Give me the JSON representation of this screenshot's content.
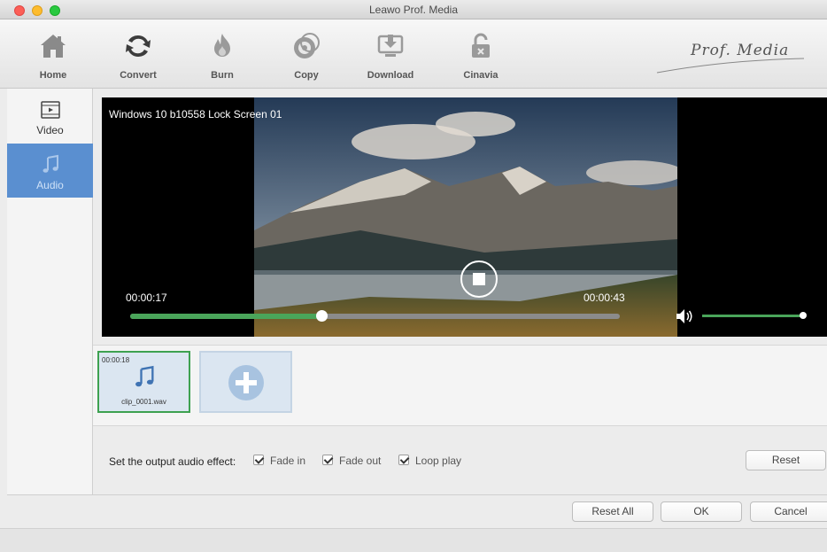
{
  "window": {
    "title": "Leawo Prof. Media"
  },
  "toolbar": {
    "items": [
      {
        "label": "Home",
        "icon": "home-icon"
      },
      {
        "label": "Convert",
        "icon": "convert-icon"
      },
      {
        "label": "Burn",
        "icon": "burn-icon"
      },
      {
        "label": "Copy",
        "icon": "copy-icon"
      },
      {
        "label": "Download",
        "icon": "download-icon"
      },
      {
        "label": "Cinavia",
        "icon": "cinavia-icon"
      }
    ],
    "brand": "Prof. Media"
  },
  "sidebar": {
    "items": [
      {
        "label": "Video",
        "icon": "film-icon",
        "active": false
      },
      {
        "label": "Audio",
        "icon": "music-note-icon",
        "active": true
      }
    ]
  },
  "player": {
    "title": "Windows 10 b10558 Lock Screen 01",
    "current_time": "00:00:17",
    "duration": "00:00:43",
    "progress": 0.39,
    "volume": 1.0
  },
  "clips": [
    {
      "duration": "00:00:18",
      "name": "clip_0001.wav",
      "selected": true
    }
  ],
  "effects": {
    "label": "Set the output audio effect:",
    "options": [
      {
        "label": "Fade in",
        "checked": true
      },
      {
        "label": "Fade out",
        "checked": true
      },
      {
        "label": "Loop play",
        "checked": true
      }
    ],
    "reset_label": "Reset"
  },
  "footer": {
    "reset_all_label": "Reset All",
    "ok_label": "OK",
    "cancel_label": "Cancel"
  },
  "colors": {
    "accent_blue": "#5a8fd0",
    "progress_green": "#4aa55a",
    "clip_border": "#3da150"
  }
}
